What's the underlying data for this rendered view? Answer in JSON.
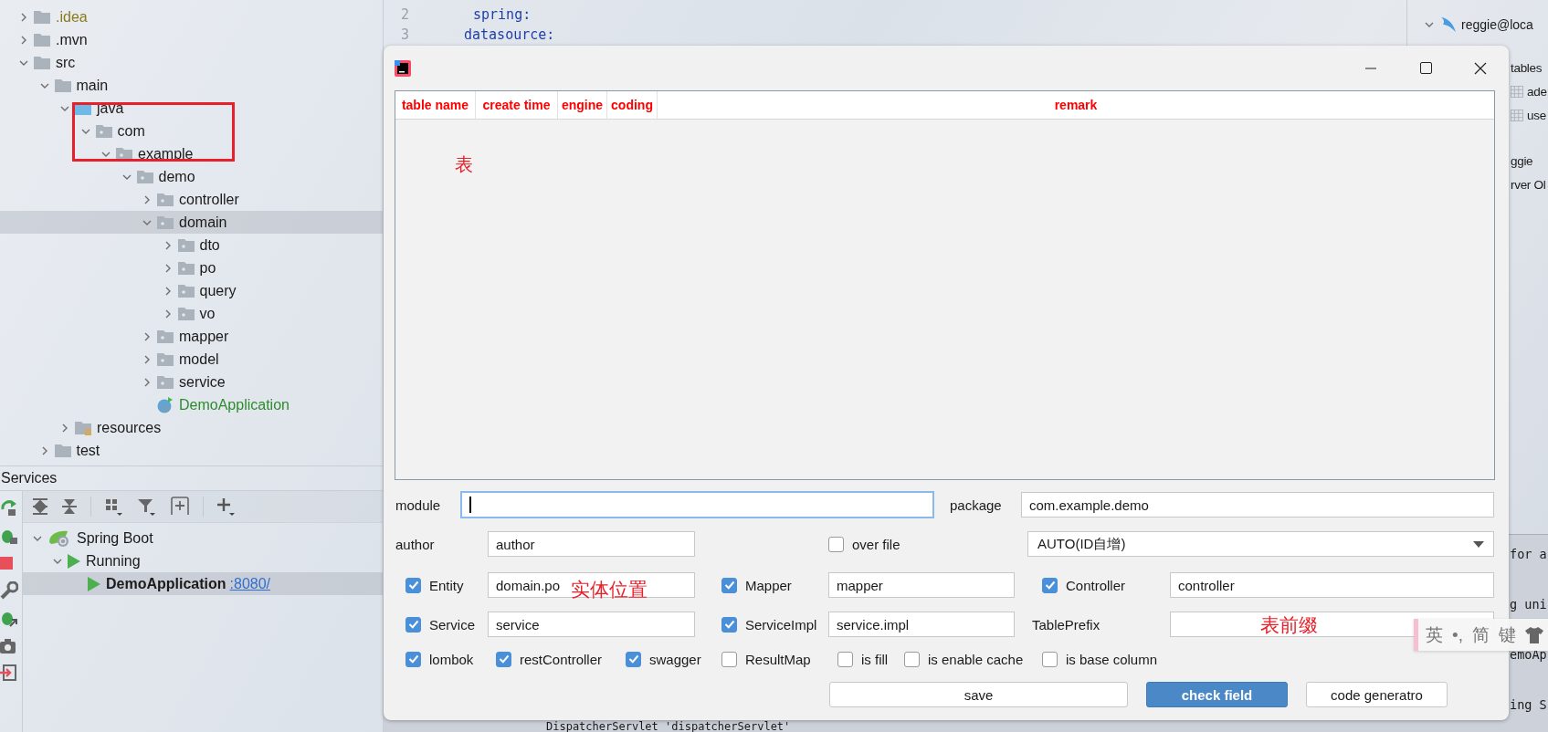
{
  "project_tree": [
    {
      "label": ".idea",
      "kind": "ignored",
      "expanded": false,
      "selected": false
    },
    {
      "label": ".mvn",
      "kind": "folder",
      "expanded": false,
      "selected": false
    },
    {
      "label": "src",
      "kind": "folder",
      "expanded": true,
      "selected": false,
      "children": [
        {
          "label": "main",
          "kind": "folder",
          "expanded": true,
          "selected": false,
          "children": [
            {
              "label": "java",
              "kind": "source-root",
              "expanded": true,
              "selected": false,
              "children": [
                {
                  "label": "com",
                  "kind": "package",
                  "expanded": true,
                  "selected": false,
                  "children": [
                    {
                      "label": "example",
                      "kind": "package",
                      "expanded": true,
                      "selected": false,
                      "children": [
                        {
                          "label": "demo",
                          "kind": "package",
                          "expanded": true,
                          "selected": false,
                          "children": [
                            {
                              "label": "controller",
                              "kind": "package",
                              "expanded": false,
                              "selected": false
                            },
                            {
                              "label": "domain",
                              "kind": "package",
                              "expanded": true,
                              "selected": true,
                              "children": [
                                {
                                  "label": "dto",
                                  "kind": "package",
                                  "expanded": false,
                                  "selected": false
                                },
                                {
                                  "label": "po",
                                  "kind": "package",
                                  "expanded": false,
                                  "selected": false
                                },
                                {
                                  "label": "query",
                                  "kind": "package",
                                  "expanded": false,
                                  "selected": false
                                },
                                {
                                  "label": "vo",
                                  "kind": "package",
                                  "expanded": false,
                                  "selected": false
                                }
                              ]
                            },
                            {
                              "label": "mapper",
                              "kind": "package",
                              "expanded": false,
                              "selected": false
                            },
                            {
                              "label": "model",
                              "kind": "package",
                              "expanded": false,
                              "selected": false
                            },
                            {
                              "label": "service",
                              "kind": "package",
                              "expanded": false,
                              "selected": false
                            },
                            {
                              "label": "DemoApplication",
                              "kind": "class",
                              "selected": false
                            }
                          ]
                        }
                      ]
                    }
                  ]
                }
              ]
            },
            {
              "label": "resources",
              "kind": "resources",
              "expanded": false,
              "selected": false
            }
          ]
        },
        {
          "label": "test",
          "kind": "folder",
          "expanded": false,
          "selected": false
        }
      ]
    }
  ],
  "annotations": [
    {
      "kind": "box"
    }
  ],
  "services": {
    "title": "Services",
    "tree": [
      {
        "label": "Spring Boot",
        "kind": "spring",
        "expanded": true,
        "selected": false,
        "children": [
          {
            "label": "Running",
            "kind": "running",
            "expanded": true,
            "selected": false,
            "children": [
              {
                "label": "DemoApplication",
                "kind": "app",
                "link": ":8080/",
                "selected": true
              }
            ]
          }
        ]
      }
    ]
  },
  "editor": {
    "lines": [
      {
        "number": "2",
        "text": "spring:"
      },
      {
        "number": "3",
        "text": "datasource:"
      }
    ]
  },
  "database_panel": {
    "root": {
      "label": "reggie@loca",
      "expanded": true
    },
    "items": [
      {
        "label": "tables",
        "kind": "group"
      },
      {
        "label": "ade",
        "kind": "table"
      },
      {
        "label": "use",
        "kind": "table"
      },
      {
        "label": "ggie",
        "kind": "schema"
      },
      {
        "label": "rver Ol",
        "kind": "node"
      }
    ]
  },
  "console": {
    "tails": [
      "for a",
      "g uni",
      "emoAp",
      "ing S"
    ],
    "last_line": "DispatcherServlet 'dispatcherServlet'"
  },
  "dialog": {
    "table": {
      "columns": [
        "table name",
        "create time",
        "engine",
        "coding",
        "remark"
      ],
      "note": "表"
    },
    "module": {
      "label": "module",
      "focused": true
    },
    "package": {
      "label": "package",
      "value": "com.example.demo"
    },
    "author": {
      "label": "author",
      "value": "author"
    },
    "over_file": {
      "label": "over file",
      "checked": false
    },
    "id_type": {
      "value": "AUTO(ID自增)"
    },
    "layers": [
      {
        "label": "Entity",
        "checked": true,
        "value": "domain.po",
        "note": "实体位置"
      },
      {
        "label": "Mapper",
        "checked": true,
        "value": "mapper"
      },
      {
        "label": "Controller",
        "checked": true,
        "value": "controller"
      },
      {
        "label": "Service",
        "checked": true,
        "value": "service"
      },
      {
        "label": "ServiceImpl",
        "checked": true,
        "value": "service.impl"
      }
    ],
    "table_prefix": {
      "label": "TablePrefix",
      "note": "表前缀"
    },
    "options": [
      {
        "label": "lombok",
        "checked": true
      },
      {
        "label": "restController",
        "checked": true
      },
      {
        "label": "swagger",
        "checked": true
      },
      {
        "label": "ResultMap",
        "checked": false
      },
      {
        "label": "is fill",
        "checked": false
      },
      {
        "label": "is enable cache",
        "checked": false
      },
      {
        "label": "is base column",
        "checked": false
      }
    ],
    "buttons": [
      {
        "label": "save",
        "kind": "default"
      },
      {
        "label": "check field",
        "kind": "primary"
      },
      {
        "label": "code generatro",
        "kind": "default"
      }
    ]
  },
  "ime_bar": {
    "items": [
      "英",
      "•,",
      "简",
      "键"
    ]
  }
}
